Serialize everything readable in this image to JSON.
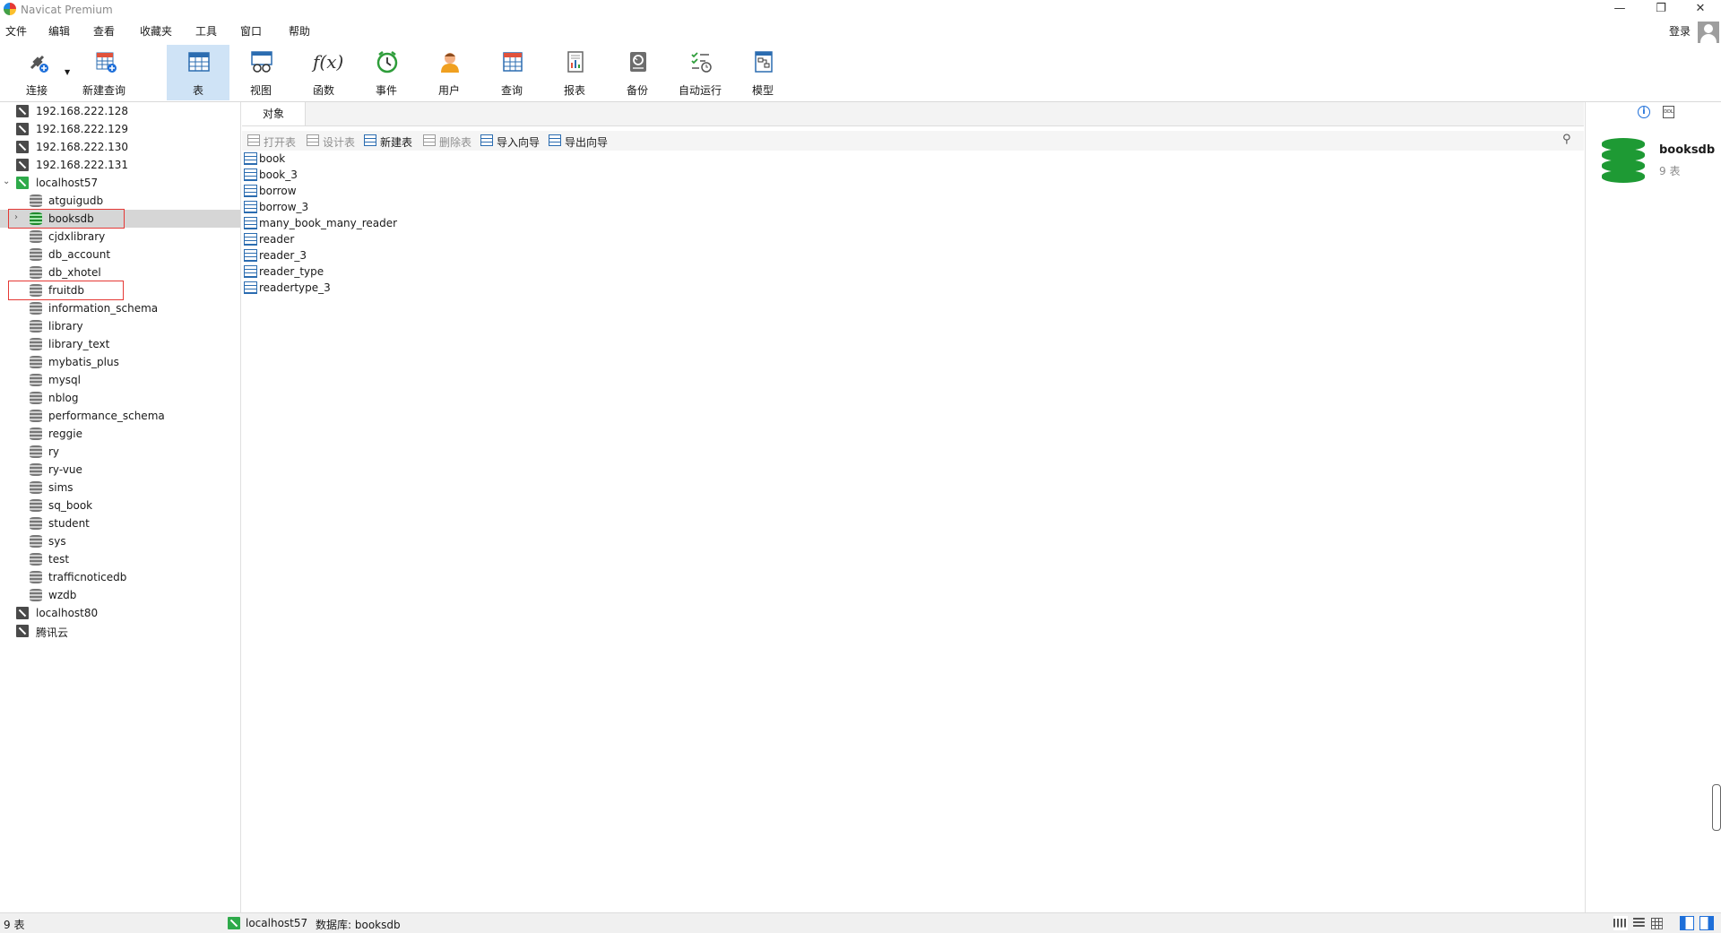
{
  "window": {
    "title": "Navicat Premium",
    "minimize": "—",
    "restore": "❐",
    "close": "✕"
  },
  "menu": [
    "文件",
    "编辑",
    "查看",
    "收藏夹",
    "工具",
    "窗口",
    "帮助"
  ],
  "account": {
    "login_label": "登录"
  },
  "toolbar": [
    {
      "id": "connect",
      "label": "连接",
      "icon": "plug-icon"
    },
    {
      "id": "new-query",
      "label": "新建查询",
      "icon": "new-query-icon"
    },
    {
      "id": "table",
      "label": "表",
      "icon": "table-icon",
      "active": true
    },
    {
      "id": "view",
      "label": "视图",
      "icon": "view-icon"
    },
    {
      "id": "function",
      "label": "函数",
      "icon": "function-icon",
      "glyph": "f(x)"
    },
    {
      "id": "event",
      "label": "事件",
      "icon": "clock-icon"
    },
    {
      "id": "user",
      "label": "用户",
      "icon": "user-icon"
    },
    {
      "id": "query",
      "label": "查询",
      "icon": "query-icon"
    },
    {
      "id": "report",
      "label": "报表",
      "icon": "report-icon"
    },
    {
      "id": "backup",
      "label": "备份",
      "icon": "backup-icon"
    },
    {
      "id": "automation",
      "label": "自动运行",
      "icon": "automation-icon"
    },
    {
      "id": "model",
      "label": "模型",
      "icon": "model-icon"
    }
  ],
  "navigator": {
    "connections_top": [
      "192.168.222.128",
      "192.168.222.129",
      "192.168.222.130",
      "192.168.222.131"
    ],
    "open_connection": {
      "name": "localhost57",
      "databases": [
        "atguigudb",
        "booksdb",
        "cjdxlibrary",
        "db_account",
        "db_xhotel",
        "fruitdb",
        "information_schema",
        "library",
        "library_text",
        "mybatis_plus",
        "mysql",
        "nblog",
        "performance_schema",
        "reggie",
        "ry",
        "ry-vue",
        "sims",
        "sq_book",
        "student",
        "sys",
        "test",
        "trafficnoticedb",
        "wzdb"
      ],
      "selected": "booksdb",
      "highlighted": [
        "booksdb",
        "fruitdb"
      ]
    },
    "connections_bottom": [
      "localhost80",
      "腾讯云"
    ]
  },
  "tabs": {
    "objects": "对象"
  },
  "object_toolbar": [
    {
      "id": "open-table",
      "label": "打开表",
      "enabled": false
    },
    {
      "id": "design-table",
      "label": "设计表",
      "enabled": false
    },
    {
      "id": "new-table",
      "label": "新建表",
      "enabled": true
    },
    {
      "id": "delete-table",
      "label": "删除表",
      "enabled": false
    },
    {
      "id": "import-wizard",
      "label": "导入向导",
      "enabled": true
    },
    {
      "id": "export-wizard",
      "label": "导出向导",
      "enabled": true
    }
  ],
  "tables": [
    "book",
    "book_3",
    "borrow",
    "borrow_3",
    "many_book_many_reader",
    "reader",
    "reader_3",
    "reader_type",
    "readertype_3"
  ],
  "info_panel": {
    "db_name": "booksdb",
    "count": "9 表",
    "ddl_label": "DDL"
  },
  "status": {
    "count": "9 表",
    "connection": "localhost57",
    "database": "数据库: booksdb"
  },
  "colors": {
    "accent": "#cfe3f6",
    "db_green": "#1e9a34",
    "highlight_box": "#e53935"
  }
}
